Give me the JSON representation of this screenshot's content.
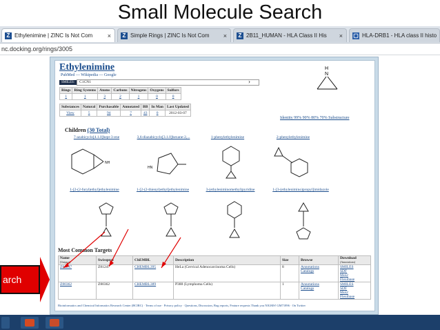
{
  "slide": {
    "title": "Small Molecule Search",
    "side_label": "arch"
  },
  "browser": {
    "tabs": [
      {
        "label": "Ethylenimine | ZINC Is Not Com",
        "close": "×"
      },
      {
        "label": "Simple Rings | ZINC Is Not Com",
        "close": "×"
      },
      {
        "label": "2B11_HUMAN - HLA Class II His",
        "close": "×"
      },
      {
        "label": "HLA-DRB1 - HLA class II histo",
        "close": ""
      }
    ],
    "address": "nc.docking.org/rings/3005"
  },
  "molecule": {
    "name": "Ethylenimine",
    "links": "PubMed — Wikipedia — Google",
    "smiles_tag": "SMILES:",
    "smiles": "C1CN1",
    "nav_arrow": "›",
    "structure_label": "H N"
  },
  "rings_table": {
    "headers": [
      "Rings",
      "Ring Systems",
      "Atoms",
      "Carbons",
      "Nitrogens",
      "Oxygens",
      "Sulfurs"
    ],
    "values": [
      "1",
      "1",
      "3",
      "2",
      "1",
      "0",
      "0"
    ]
  },
  "substances_table": {
    "headers": [
      "Substances",
      "Natural",
      "Purchasable",
      "Annotated",
      "BB",
      "In Man",
      "Last Updated"
    ],
    "values": [
      "View",
      "5",
      "94",
      "7",
      "43",
      "0",
      "2012-03-07"
    ]
  },
  "identity": "Identity 99% 90% 80% 70% Substructure",
  "children": {
    "heading": "Children",
    "count": "(30 Total)",
    "items": [
      "7-azabicyclo[4.1.0]hept-3-ene",
      "3,6-diazabicyclo[3.1.0]hexane-2,...",
      "1-phenylethylenimine",
      "2-phenylethylenimine",
      "1-[2-(2-furyl)ethyl]ethylenimine",
      "1-[2-(2-thienyl)ethyl]ethylenimine",
      "3-(ethyleniminomethyl)pyridine",
      "1-[3-(ethylenimino)propyl]imidazole"
    ]
  },
  "targets": {
    "heading": "Most Common Targets",
    "headers": [
      "Name",
      "Swissprot",
      "ChEMBL",
      "Description",
      "Size",
      "Browse",
      "Download"
    ],
    "sub_headers": [
      "(Uniprot)",
      "",
      "",
      "",
      "",
      "",
      "(Annotations)"
    ],
    "rows": [
      {
        "name": "Z81247",
        "swissprot": "Z81247",
        "chembl": "CHEMBL395",
        "desc": "HeLa (Cervical Adenocarcinoma Cells)",
        "size": "8",
        "browse": [
          "Annotations",
          "Catalogs"
        ],
        "download": [
          "SMILES",
          "SDF",
          "Mol2",
          "Flexibase"
        ]
      },
      {
        "name": "Z80362",
        "swissprot": "Z80362",
        "chembl": "CHEMBL389",
        "desc": "P388 (Lymphoma Cells)",
        "size": "1",
        "browse": [
          "Annotations",
          "Catalogs"
        ],
        "download": [
          "SMILES",
          "SDF",
          "Mol2",
          "Flexibase"
        ]
      }
    ]
  },
  "footer": "Bioinformatics and Chemical Informatics Research Center (BCIRC) · Terms of use · Privacy policy · Questions, Discussion, Bug reports, Feature requests Thank you NIGMS! GM71896 · On Twitter"
}
